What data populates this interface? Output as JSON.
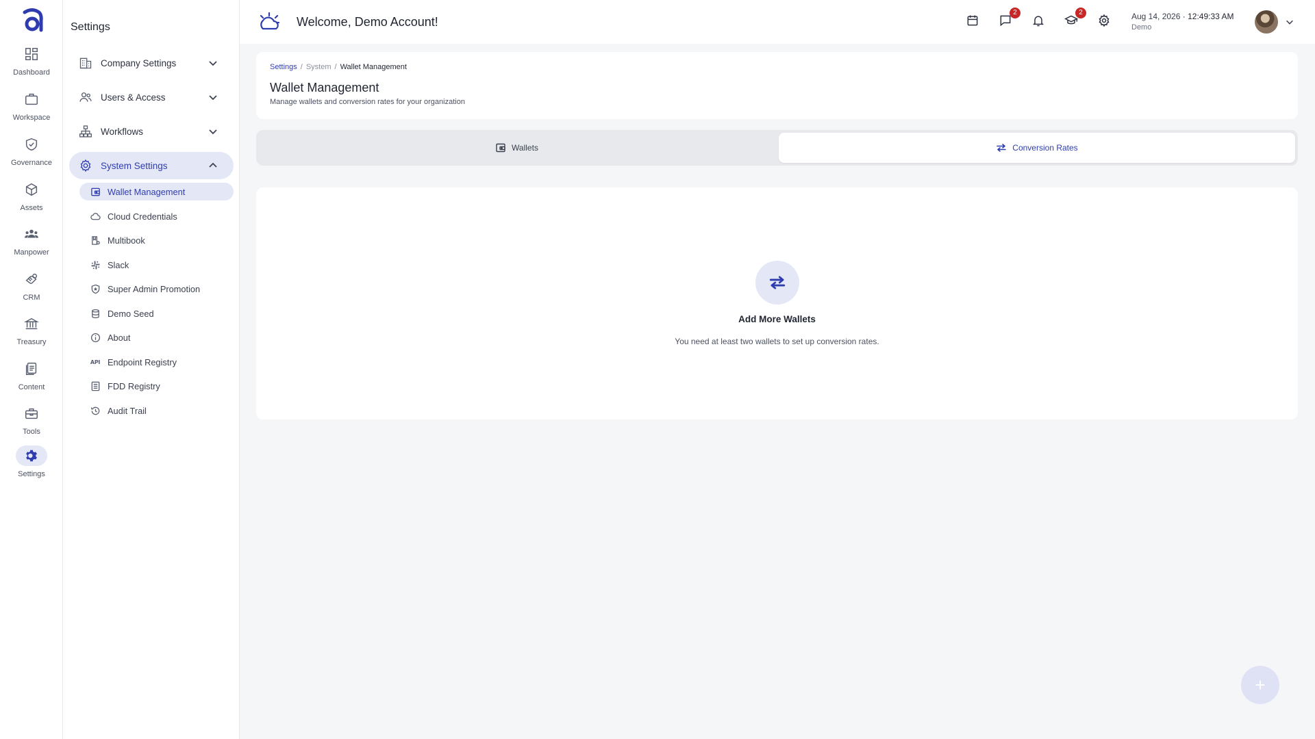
{
  "rail": {
    "logo": "a-logo",
    "items": [
      {
        "label": "Dashboard",
        "icon": "dashboard-icon"
      },
      {
        "label": "Workspace",
        "icon": "briefcase-icon"
      },
      {
        "label": "Governance",
        "icon": "shield-check-icon"
      },
      {
        "label": "Assets",
        "icon": "cube-icon"
      },
      {
        "label": "Manpower",
        "icon": "people-icon"
      },
      {
        "label": "CRM",
        "icon": "handshake-icon"
      },
      {
        "label": "Treasury",
        "icon": "bank-icon"
      },
      {
        "label": "Content",
        "icon": "document-icon"
      },
      {
        "label": "Tools",
        "icon": "toolbox-icon"
      },
      {
        "label": "Settings",
        "icon": "gear-icon"
      }
    ],
    "active": "Settings"
  },
  "panel": {
    "title": "Settings",
    "groups": [
      {
        "label": "Company Settings",
        "icon": "building-icon",
        "expanded": false
      },
      {
        "label": "Users & Access",
        "icon": "users-icon",
        "expanded": false
      },
      {
        "label": "Workflows",
        "icon": "sitemap-icon",
        "expanded": false
      },
      {
        "label": "System Settings",
        "icon": "gear-icon",
        "expanded": true
      }
    ],
    "system_items": [
      {
        "label": "Wallet Management",
        "icon": "wallet-icon",
        "active": true
      },
      {
        "label": "Cloud Credentials",
        "icon": "cloud-icon"
      },
      {
        "label": "Multibook",
        "icon": "book-icon"
      },
      {
        "label": "Slack",
        "icon": "slack-icon"
      },
      {
        "label": "Super Admin Promotion",
        "icon": "shield-star-icon"
      },
      {
        "label": "Demo Seed",
        "icon": "database-icon"
      },
      {
        "label": "About",
        "icon": "info-icon"
      },
      {
        "label": "Endpoint Registry",
        "icon": "api-icon",
        "glyph": "API"
      },
      {
        "label": "FDD Registry",
        "icon": "list-doc-icon"
      },
      {
        "label": "Audit Trail",
        "icon": "history-icon"
      }
    ]
  },
  "header": {
    "welcome": "Welcome, Demo Account!",
    "icons": [
      {
        "name": "calendar-icon"
      },
      {
        "name": "chat-icon",
        "badge": "2"
      },
      {
        "name": "bell-icon"
      },
      {
        "name": "graduation-cap-icon",
        "badge": "2"
      },
      {
        "name": "gear-icon"
      }
    ],
    "date": "Aug 14, 2026",
    "separator": "·",
    "time": "12:49:33 AM",
    "org": "Demo"
  },
  "page": {
    "breadcrumb": [
      "Settings",
      "System",
      "Wallet Management"
    ],
    "breadcrumb_sep": "/",
    "title": "Wallet Management",
    "subtitle": "Manage wallets and conversion rates for your organization"
  },
  "tabs": [
    {
      "label": "Wallets",
      "icon": "wallet-icon",
      "selected": false
    },
    {
      "label": "Conversion Rates",
      "icon": "swap-arrows-icon",
      "selected": true
    }
  ],
  "empty_state": {
    "icon": "swap-arrows-icon",
    "title": "Add More Wallets",
    "text": "You need at least two wallets to set up conversion rates."
  },
  "fab": {
    "icon": "plus-icon",
    "label": "+"
  },
  "colors": {
    "accent": "#2f3cb0",
    "accent_soft": "#e4e7f6",
    "badge": "#c62828",
    "background": "#f5f6f8"
  }
}
